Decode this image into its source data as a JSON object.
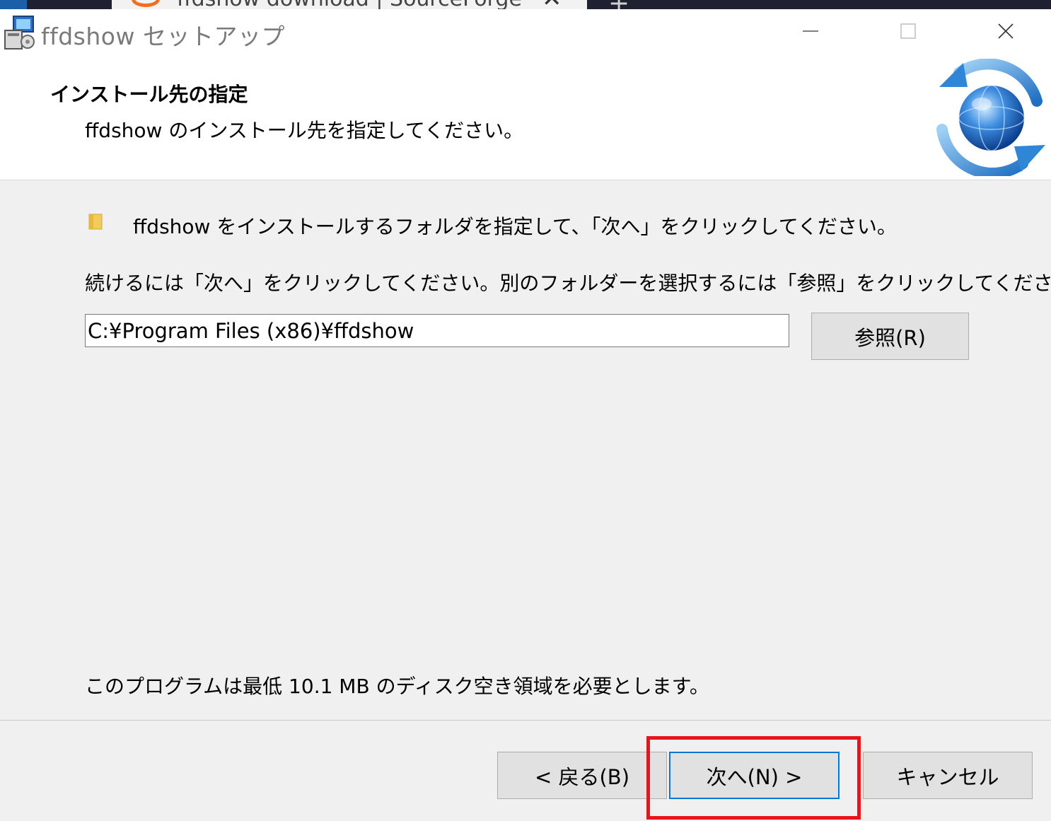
{
  "background_window": {
    "tab_title": "ffdshow download | SourceForge",
    "tab_close_glyph": "✕",
    "new_tab_glyph": "+"
  },
  "window": {
    "title": "ffdshow セットアップ",
    "icon": "installer-icon",
    "controls": {
      "minimize_icon": "minimize-icon",
      "maximize_icon": "maximize-icon",
      "close_icon": "close-icon"
    }
  },
  "header": {
    "title": "インストール先の指定",
    "subtitle": "ffdshow のインストール先を指定してください。",
    "logo_icon": "globe-refresh-icon"
  },
  "body": {
    "folder_icon": "folder-icon",
    "instruction": "ffdshow をインストールするフォルダを指定して、「次へ」をクリックしてください。",
    "hint": "続けるには「次へ」をクリックしてください。別のフォルダーを選択するには「参照」をクリックしてください。",
    "install_path": "C:¥Program Files (x86)¥ffdshow",
    "browse_label": "参照(R)",
    "space_required": "このプログラムは最低 10.1 MB のディスク空き領域を必要とします。"
  },
  "footer": {
    "back_label": "< 戻る(B)",
    "next_label": "次へ(N) >",
    "cancel_label": "キャンセル"
  },
  "colors": {
    "highlight": "#e8131b",
    "default_button_border": "#0078d7",
    "dialog_body": "#f0f0f0"
  }
}
